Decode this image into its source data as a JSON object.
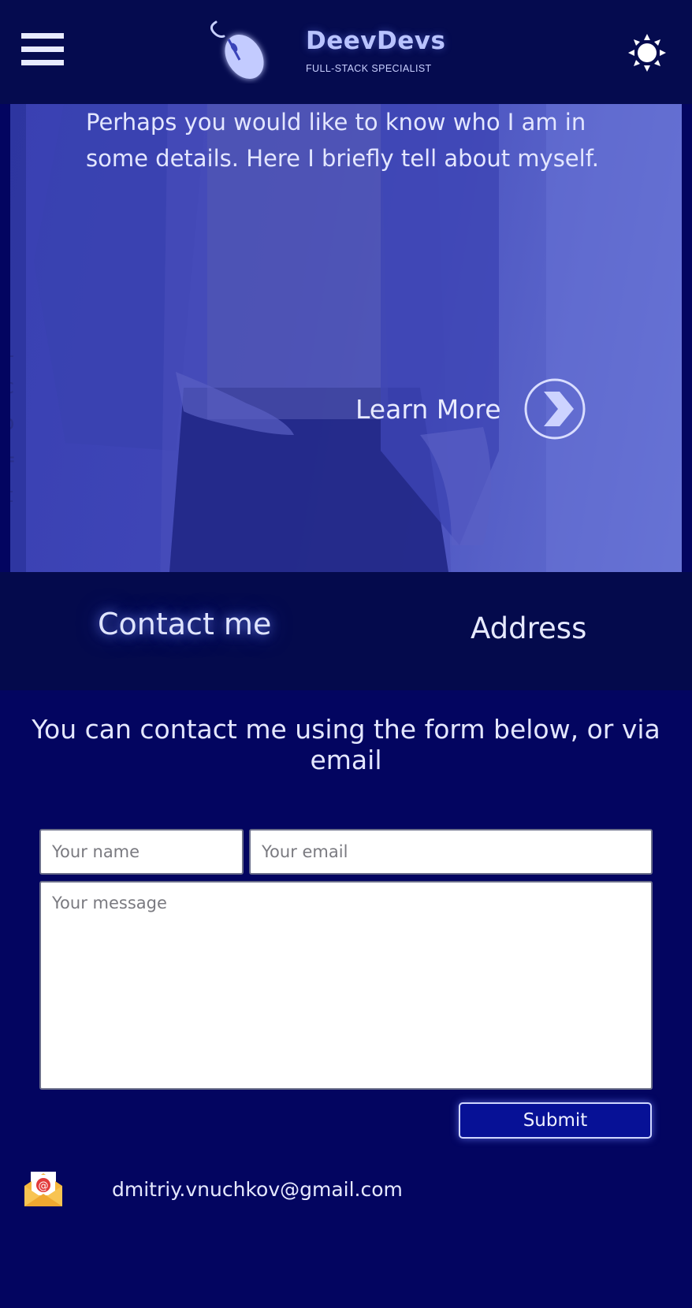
{
  "header": {
    "menu_icon": "hamburger-menu-icon",
    "logo_icon": "computer-mouse-icon",
    "brand_name": "DeevDevs",
    "brand_tagline": "FULL-STACK SPECIALIST",
    "theme_icon": "sun-icon"
  },
  "hero": {
    "intro_text": "Perhaps you would like to know who I am in some details. Here I briefly tell about myself.",
    "learn_more_label": "Learn More",
    "learn_more_icon": "chevron-right-circle-icon"
  },
  "contact_tabs": {
    "contact_label": "Contact me",
    "address_label": "Address"
  },
  "contact_form": {
    "heading": "You can contact me using the form below, or via email",
    "name_placeholder": "Your name",
    "email_placeholder": "Your email",
    "message_placeholder": "Your message",
    "submit_label": "Submit"
  },
  "email": {
    "icon": "envelope-icon",
    "address": "dmitriy.vnuchkov@gmail.com"
  },
  "colors": {
    "page_background": "#030560",
    "header_background": "#050b4f",
    "tabs_background": "#040a4c",
    "hero_overlay": "#4047b8",
    "submit_background": "#071196",
    "text": "#dfe3ff"
  }
}
